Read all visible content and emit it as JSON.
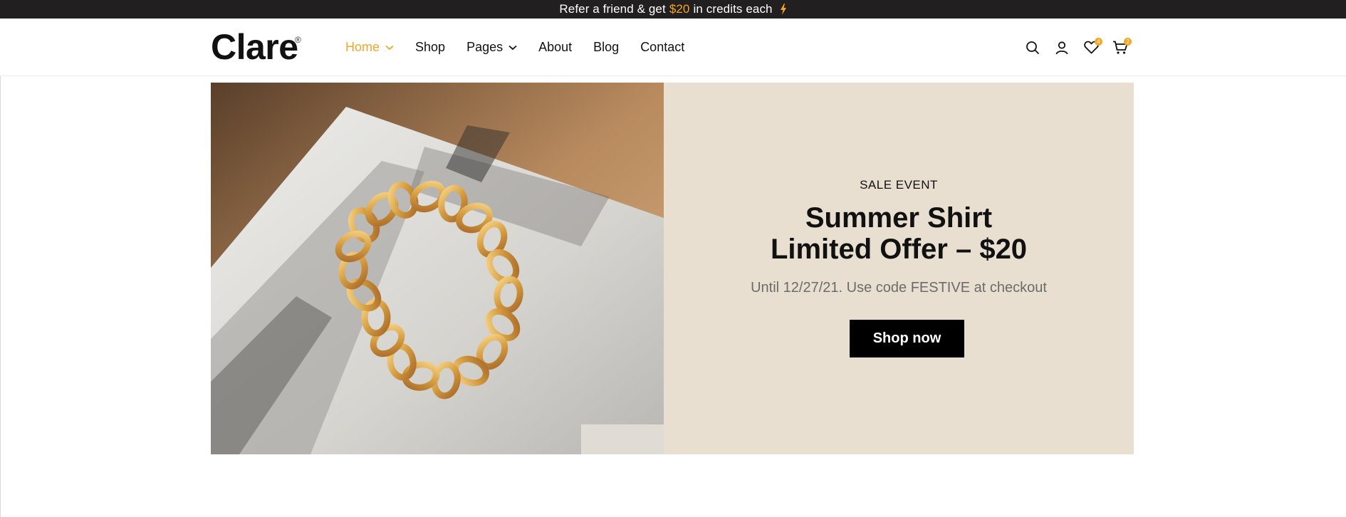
{
  "announcement": {
    "before": "Refer a friend & get",
    "amount": "$20",
    "after": "in credits each",
    "icon": "lightning-bolt-icon",
    "accent_color": "#f5a623"
  },
  "header": {
    "logo": "Clare",
    "logo_mark": "®",
    "nav": [
      {
        "label": "Home",
        "has_dropdown": true,
        "active": true
      },
      {
        "label": "Shop",
        "has_dropdown": false
      },
      {
        "label": "Pages",
        "has_dropdown": true
      },
      {
        "label": "About",
        "has_dropdown": false
      },
      {
        "label": "Blog",
        "has_dropdown": false
      },
      {
        "label": "Contact",
        "has_dropdown": false
      }
    ],
    "actions": {
      "search": "search-icon",
      "account": "user-icon",
      "wishlist": {
        "icon": "heart-icon",
        "count": "4"
      },
      "cart": {
        "icon": "cart-icon",
        "count": "2"
      }
    },
    "active_color": "#f0a52b"
  },
  "hero": {
    "image": "gold-chain-bracelet-on-magazine",
    "eyebrow": "SALE EVENT",
    "headline_line1": "Summer Shirt",
    "headline_line2": "Limited Offer – $20",
    "subtext": "Until 12/27/21. Use code FESTIVE at checkout",
    "cta_label": "Shop now",
    "panel_color": "#e8dfd0"
  }
}
